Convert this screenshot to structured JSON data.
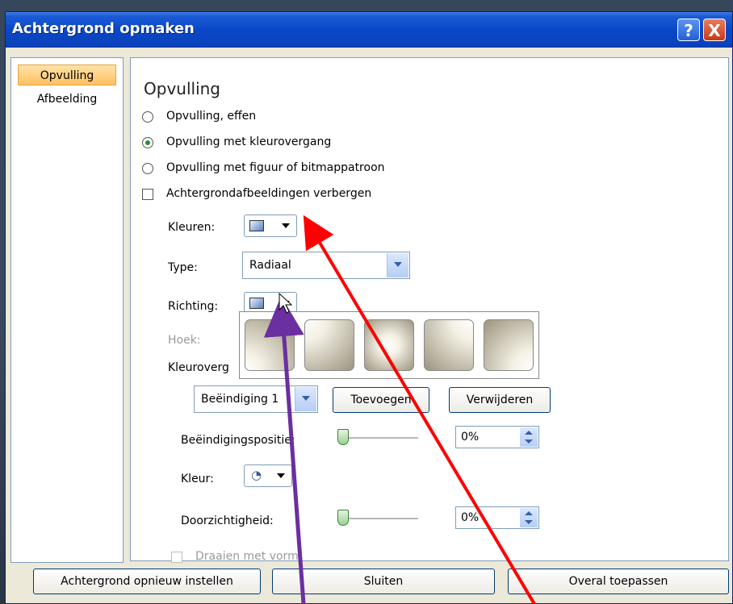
{
  "window": {
    "title": "Achtergrond opmaken",
    "help_icon": "?",
    "close_icon": "X"
  },
  "sidebar": {
    "items": [
      {
        "label": "Opvulling",
        "selected": true
      },
      {
        "label": "Afbeelding",
        "selected": false
      }
    ]
  },
  "section": {
    "title": "Opvulling"
  },
  "fill_options": {
    "solid": "Opvulling, effen",
    "gradient": "Opvulling met kleurovergang",
    "picture": "Opvulling met figuur of bitmappatroon",
    "hide_background": "Achtergrondafbeeldingen verbergen"
  },
  "controls": {
    "colors_label": "Kleuren:",
    "type_label": "Type:",
    "type_value": "Radiaal",
    "direction_label": "Richting:",
    "angle_label": "Hoek:",
    "gradient_stops_label": "Kleuroverg",
    "stop_value": "Beëindiging 1",
    "add_button": "Toevoegen",
    "remove_button": "Verwijderen",
    "stop_position_label": "Beëindigingspositie:",
    "stop_position_value": "0%",
    "color_label": "Kleur:",
    "transparency_label": "Doorzichtigheid:",
    "transparency_value": "0%",
    "rotate_label": "Draaien met vorm"
  },
  "footer": {
    "reset_button": "Achtergrond opnieuw instellen",
    "close_button": "Sluiten",
    "apply_all_button": "Overal toepassen"
  },
  "colors": {
    "title_bar": "#0a47c8",
    "arrow_red": "#ff0000",
    "arrow_purple": "#6a2fa0",
    "accent_selected": "#ffc163"
  }
}
